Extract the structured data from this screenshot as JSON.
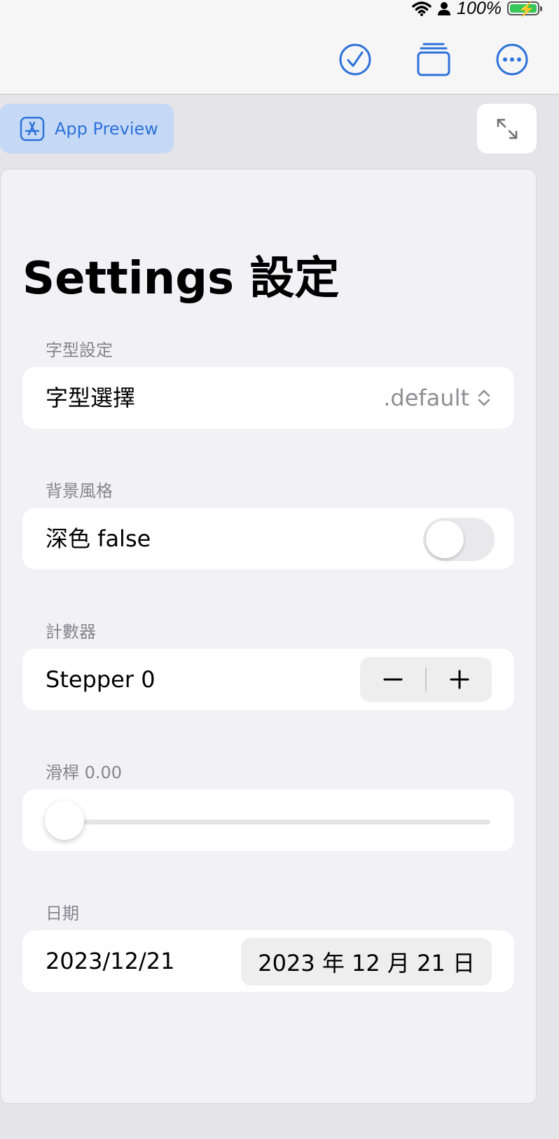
{
  "status_bar": {
    "battery_percent": "100%"
  },
  "toolbar": {
    "icons": [
      "checkmark-circle-icon",
      "stack-icon",
      "ellipsis-circle-icon"
    ],
    "accent": "#2e72d9"
  },
  "preview": {
    "label": "App Preview",
    "icon": "app-store-icon"
  },
  "expand": {
    "icon": "expand-arrows-icon"
  },
  "page": {
    "title": "Settings 設定"
  },
  "font_section": {
    "header": "字型設定",
    "label": "字型選擇",
    "value": ".default"
  },
  "background_section": {
    "header": "背景風格",
    "label": "深色 false",
    "toggle_on": false
  },
  "counter_section": {
    "header": "計數器",
    "label": "Stepper 0",
    "value": 0
  },
  "slider_section": {
    "header": "滑桿 0.00",
    "value": 0.0
  },
  "date_section": {
    "header": "日期",
    "label": "2023/12/21",
    "picker_value": "2023 年 12 月 21 日"
  }
}
